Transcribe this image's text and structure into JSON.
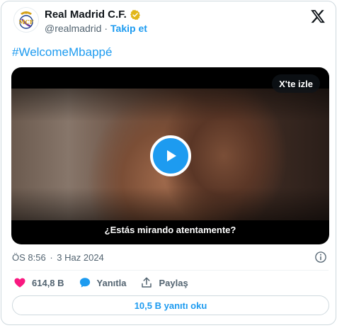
{
  "author": {
    "display_name": "Real Madrid C.F.",
    "handle": "@realmadrid",
    "separator": "·",
    "follow_label": "Takip et"
  },
  "tweet": {
    "text": "#WelcomeMbappé"
  },
  "media": {
    "watch_on_x_label": "X'te izle",
    "subtitle": "¿Estás mirando atentamente?"
  },
  "meta": {
    "time": "ÖS 8:56",
    "separator": "·",
    "date": "3 Haz 2024"
  },
  "actions": {
    "like_count": "614,8 B",
    "reply_label": "Yanıtla",
    "share_label": "Paylaş"
  },
  "read_replies_label": "10,5 B yanıtı oku",
  "colors": {
    "accent": "#1d9bf0",
    "like": "#f91880",
    "verified_gold": "#e2b719",
    "text_secondary": "#536471",
    "border": "#cfd9de"
  },
  "icons": [
    "real-madrid-crest-icon",
    "verified-badge-icon",
    "x-logo-icon",
    "play-icon",
    "info-icon",
    "heart-icon",
    "reply-icon",
    "share-icon"
  ]
}
